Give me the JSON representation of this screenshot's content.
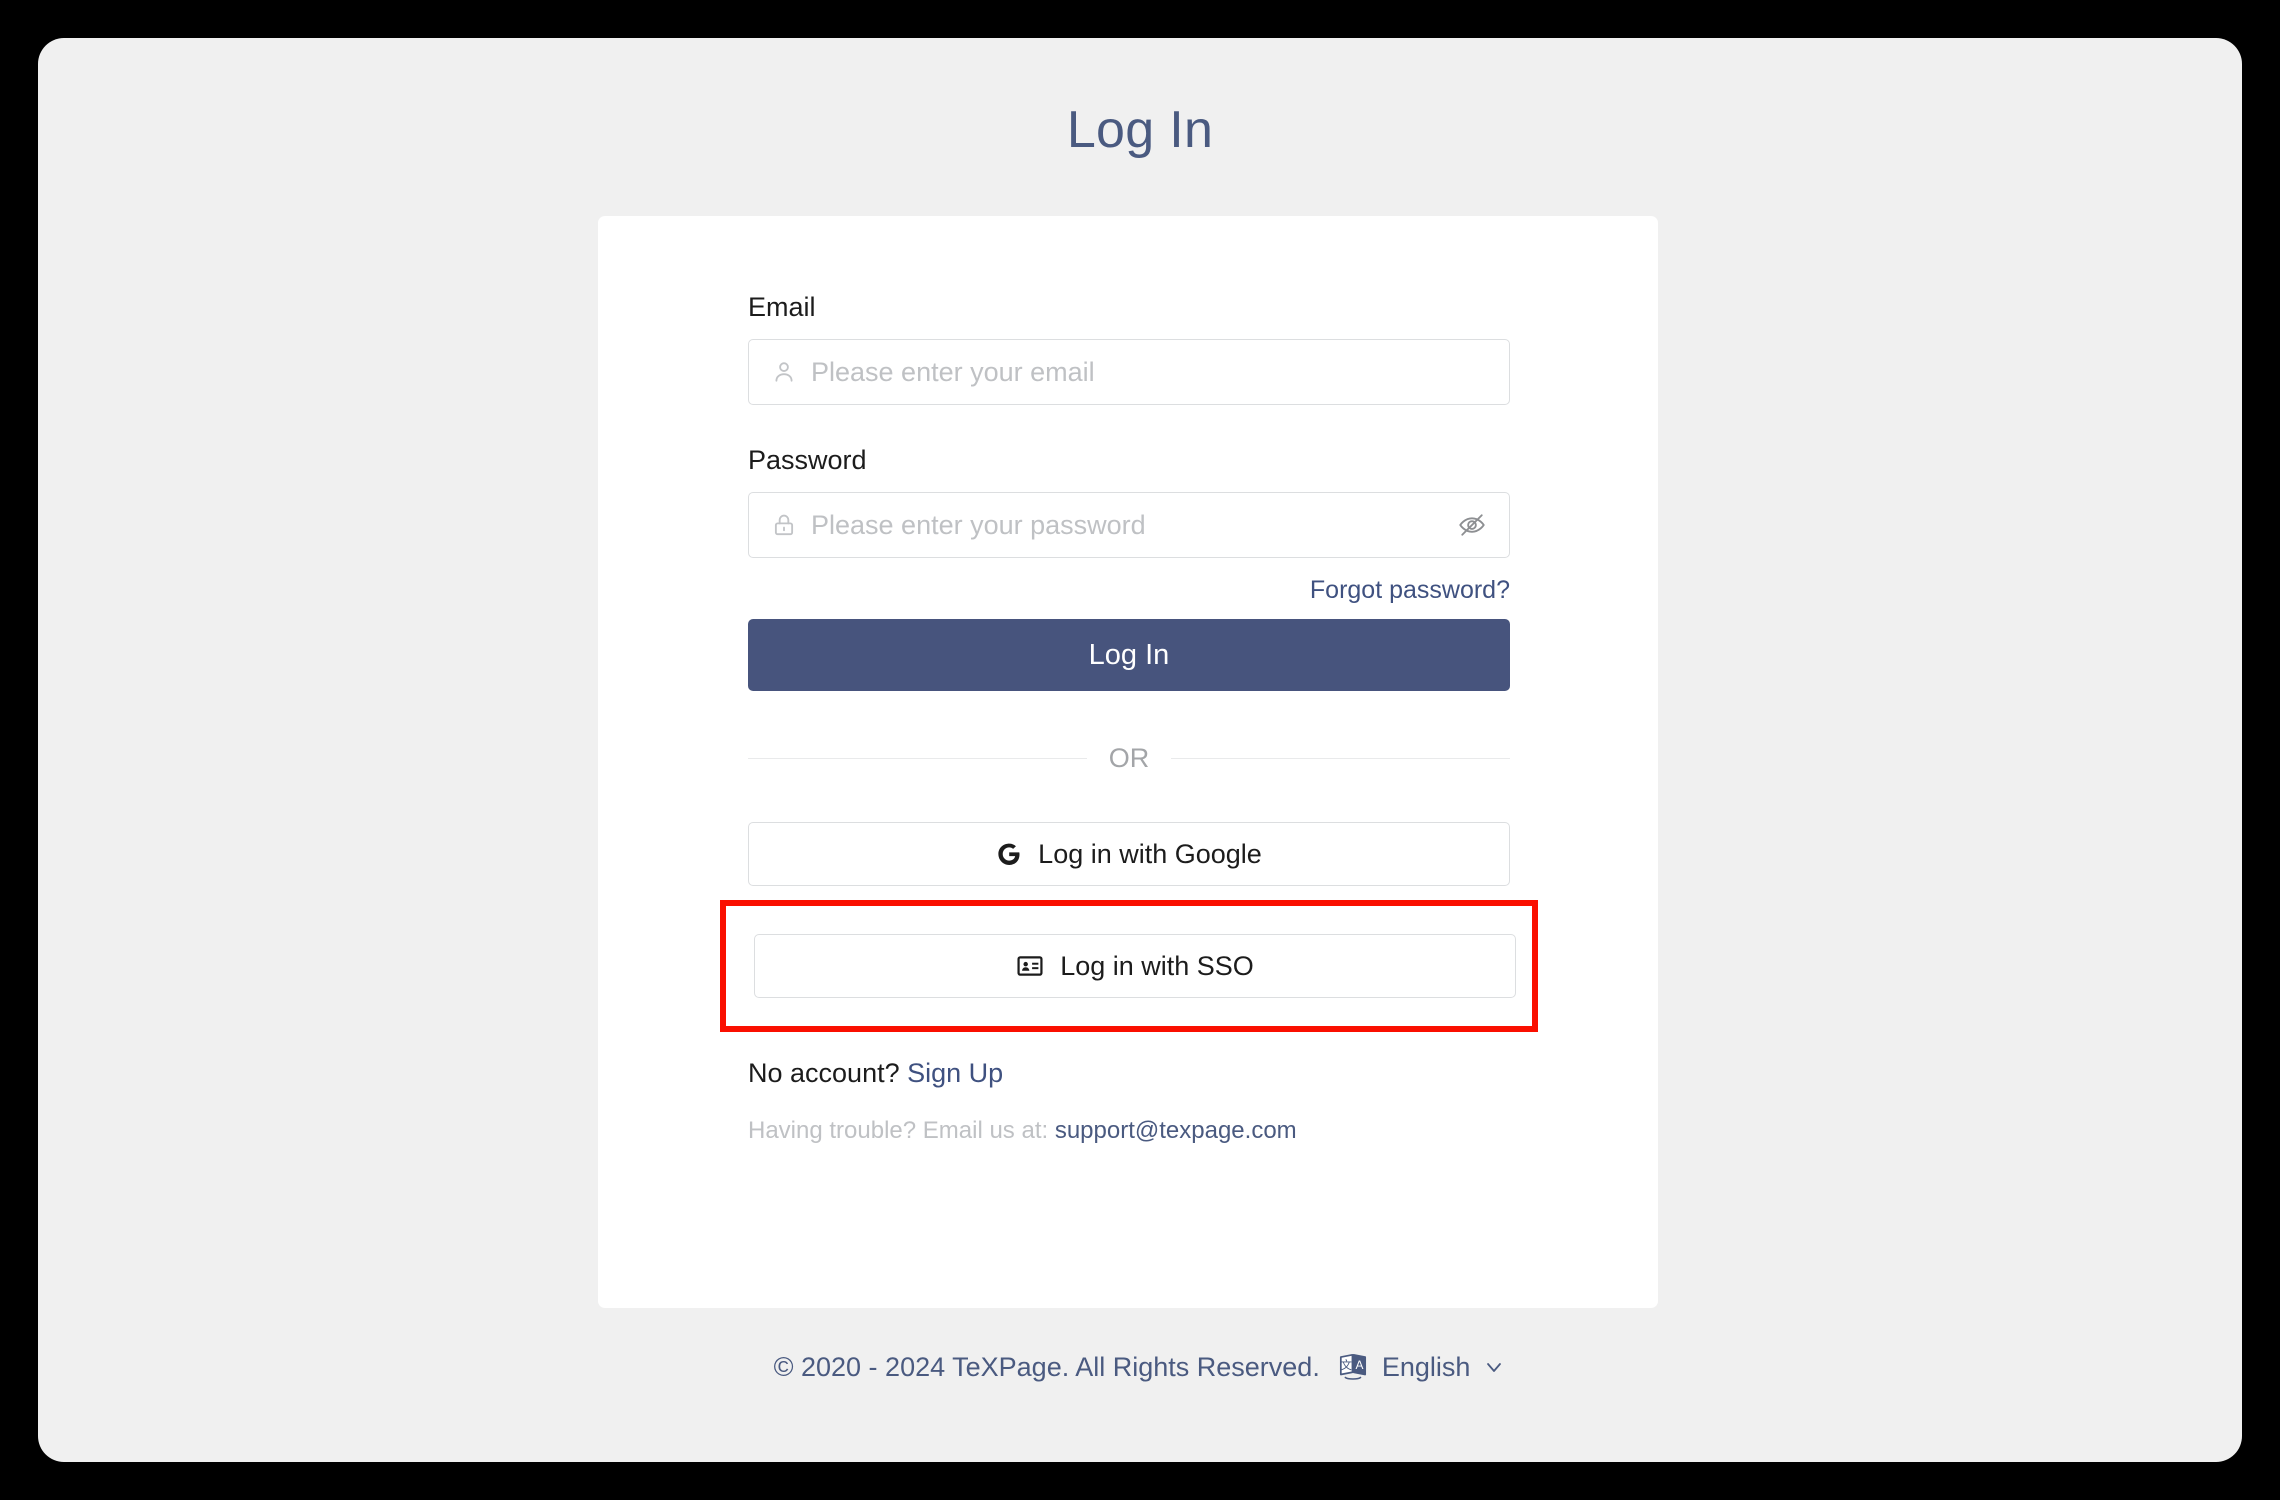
{
  "page": {
    "title": "Log In",
    "accent_color": "#47547d",
    "title_color": "#4a5a80",
    "background_color": "#f0f0f0",
    "card_background": "#ffffff",
    "highlight_color": "#fa0f00"
  },
  "form": {
    "email": {
      "label": "Email",
      "placeholder": "Please enter your email",
      "value": "",
      "icon": "user-icon"
    },
    "password": {
      "label": "Password",
      "placeholder": "Please enter your password",
      "value": "",
      "icon": "lock-icon",
      "toggle_icon": "eye-off-icon"
    },
    "forgot_password_label": "Forgot password?",
    "submit_label": "Log In"
  },
  "divider": {
    "label": "OR"
  },
  "oauth": {
    "google": {
      "label": "Log in with Google",
      "icon": "google-g-icon"
    },
    "sso": {
      "label": "Log in with SSO",
      "icon": "id-card-icon",
      "highlighted": true
    }
  },
  "signup": {
    "prompt": "No account?",
    "link_label": "Sign Up"
  },
  "support": {
    "prompt": "Having trouble? Email us at:",
    "email": "support@texpage.com"
  },
  "footer": {
    "copyright": "© 2020 - 2024 TeXPage. All Rights Reserved.",
    "language_icon": "translate-icon",
    "language_label": "English",
    "chevron": "chevron-down-icon"
  }
}
